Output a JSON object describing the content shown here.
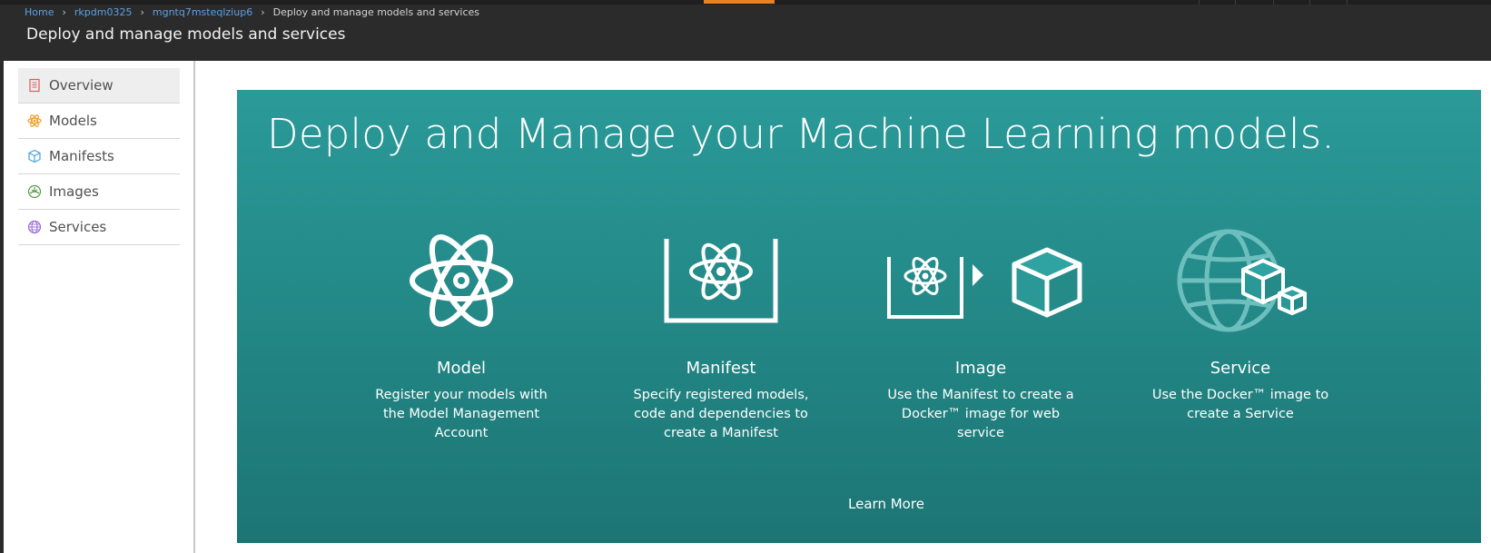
{
  "breadcrumb": {
    "items": [
      "Home",
      "rkpdm0325",
      "mgntq7msteqlziup6"
    ],
    "current": "Deploy and manage models and services"
  },
  "header": {
    "title": "Deploy and manage models and services"
  },
  "sidebar": {
    "items": [
      {
        "label": "Overview",
        "icon": "overview-icon",
        "active": true
      },
      {
        "label": "Models",
        "icon": "models-icon"
      },
      {
        "label": "Manifests",
        "icon": "manifests-icon"
      },
      {
        "label": "Images",
        "icon": "images-icon"
      },
      {
        "label": "Services",
        "icon": "services-icon"
      }
    ]
  },
  "main": {
    "hero_title": "Deploy and Manage your Machine Learning models.",
    "cards": [
      {
        "title": "Model",
        "description": "Register your models with the Model Management Account",
        "icon": "atom-icon"
      },
      {
        "title": "Manifest",
        "description": "Specify registered models, code and dependencies to create a Manifest",
        "icon": "manifest-icon"
      },
      {
        "title": "Image",
        "description": "Use the Manifest to create a Docker™ image for web service",
        "icon": "image-icon"
      },
      {
        "title": "Service",
        "description": "Use the Docker™ image to create a Service",
        "icon": "service-icon"
      }
    ],
    "learn_more": "Learn More"
  },
  "colors": {
    "accent": "#e8821f",
    "panel_top": "#2a9a99",
    "panel_bottom": "#1c7574",
    "link": "#5ba2e6"
  }
}
